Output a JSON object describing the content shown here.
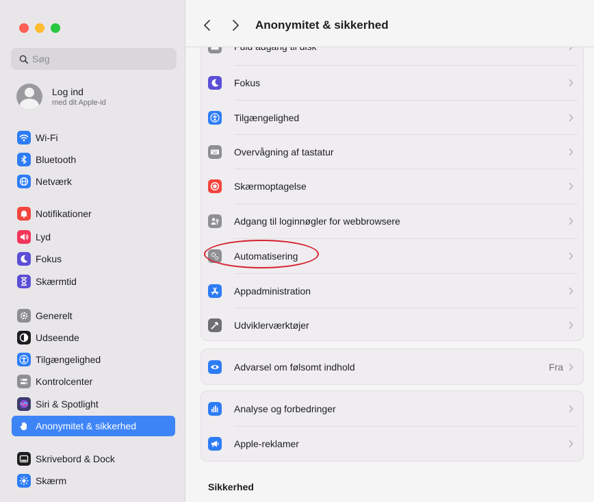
{
  "window": {
    "title": "Anonymitet & sikkerhed",
    "back_glyph": "‹",
    "forward_glyph": "›"
  },
  "sidebar": {
    "search": {
      "placeholder": "Søg",
      "value": ""
    },
    "account": {
      "title": "Log ind",
      "subtitle": "med dit Apple-id"
    },
    "items": [
      {
        "label": "Wi-Fi",
        "icon": "wifi-icon",
        "color": "#2d7cf6"
      },
      {
        "label": "Bluetooth",
        "icon": "bluetooth-icon",
        "color": "#2d7cf6"
      },
      {
        "label": "Netværk",
        "icon": "globe-icon",
        "color": "#2d7cf6"
      },
      {
        "label": "Notifikationer",
        "icon": "bell-icon",
        "color": "#f2453d"
      },
      {
        "label": "Lyd",
        "icon": "speaker-icon",
        "color": "#f2365b"
      },
      {
        "label": "Fokus",
        "icon": "moon-icon",
        "color": "#5b4fd6"
      },
      {
        "label": "Skærmtid",
        "icon": "hourglass-icon",
        "color": "#5b4fd6"
      },
      {
        "label": "Generelt",
        "icon": "gear-icon",
        "color": "#8e8e93"
      },
      {
        "label": "Udseende",
        "icon": "appearance-icon",
        "color": "#1d1d1f"
      },
      {
        "label": "Tilgængelighed",
        "icon": "accessibility-icon",
        "color": "#2d7cf6"
      },
      {
        "label": "Kontrolcenter",
        "icon": "control-center-icon",
        "color": "#8e8e93"
      },
      {
        "label": "Siri & Spotlight",
        "icon": "siri-icon",
        "color": "#3b3b6e"
      },
      {
        "label": "Anonymitet & sikkerhed",
        "icon": "hand-icon",
        "color": "#2d7cf6",
        "active": true
      },
      {
        "label": "Skrivebord & Dock",
        "icon": "dock-icon",
        "color": "#1d1d1f"
      },
      {
        "label": "Skærm",
        "icon": "sun-icon",
        "color": "#2d7cf6"
      }
    ]
  },
  "main": {
    "privacy_group": [
      {
        "label": "Fuld adgang til disk",
        "icon": "folder-icon",
        "color": "#8e8e93"
      },
      {
        "label": "Fokus",
        "icon": "moon-icon",
        "color": "#5b4fd6"
      },
      {
        "label": "Tilgængelighed",
        "icon": "accessibility-icon",
        "color": "#2d7cf6"
      },
      {
        "label": "Overvågning af tastatur",
        "icon": "keyboard-icon",
        "color": "#8e8e93"
      },
      {
        "label": "Skærmoptagelse",
        "icon": "record-icon",
        "color": "#f2453d"
      },
      {
        "label": "Adgang til loginnøgler for webbrowsere",
        "icon": "person-key-icon",
        "color": "#8e8e93"
      },
      {
        "label": "Automatisering",
        "icon": "gears-icon",
        "color": "#8e8e93"
      },
      {
        "label": "Appadministration",
        "icon": "app-store-icon",
        "color": "#2d7cf6"
      },
      {
        "label": "Udviklerværktøjer",
        "icon": "hammer-icon",
        "color": "#6e6e73"
      }
    ],
    "sensitive_group": [
      {
        "label": "Advarsel om følsomt indhold",
        "icon": "eye-icon",
        "color": "#2d7cf6",
        "value": "Fra"
      }
    ],
    "analytics_group": [
      {
        "label": "Analyse og forbedringer",
        "icon": "chart-icon",
        "color": "#2d7cf6"
      },
      {
        "label": "Apple-reklamer",
        "icon": "megaphone-icon",
        "color": "#2d7cf6"
      }
    ],
    "security_title": "Sikkerhed"
  },
  "annotation": {
    "color": "#d6202e",
    "target": "Automatisering"
  }
}
